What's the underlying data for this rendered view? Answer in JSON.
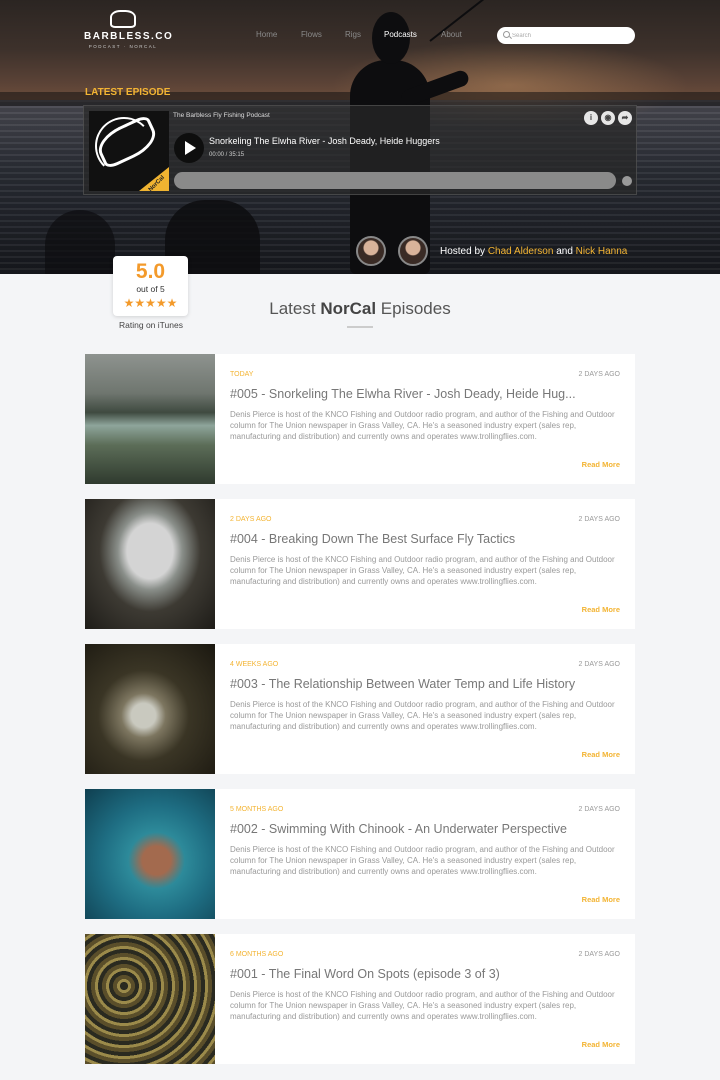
{
  "header": {
    "logo_word": "BARBLESS.CO",
    "logo_sub": "PODCAST · NORCAL",
    "nav": [
      "Home",
      "Flows",
      "Rigs",
      "Podcasts",
      "About"
    ],
    "nav_active": "Podcasts",
    "search_placeholder": "Search"
  },
  "hero": {
    "section_label": "LATEST EPISODE",
    "player": {
      "podcast_name": "The Barbless Fly Fishing Podcast",
      "episode_title": "Snorkeling The Elwha River - Josh Deady, Heide Huggers",
      "time": "00:00 / 35:15",
      "art_tag": "NorCal",
      "icons": [
        "info-icon",
        "podcast-icon",
        "share-icon"
      ]
    },
    "hosted_prefix": "Hosted by",
    "host1": "Chad Alderson",
    "hosted_and": "and",
    "host2": "Nick Hanna"
  },
  "rating": {
    "score": "5.0",
    "out_of": "out of 5",
    "stars": "★★★★★",
    "label": "Rating on iTunes"
  },
  "section": {
    "title_pre": "Latest",
    "title_bold": "NorCal",
    "title_post": "Episodes"
  },
  "episodes": [
    {
      "date": "TODAY",
      "ago": "2 DAYS AGO",
      "title": "#005 - Snorkeling The Elwha River - Josh Deady, Heide Hug...",
      "desc": "Denis Pierce is host of the KNCO Fishing and Outdoor radio program, and author of the Fishing and Outdoor column for The Union newspaper in Grass Valley, CA. He's a seasoned industry expert (sales rep, manufacturing and distribution) and currently owns and operates www.trollingflies.com.",
      "more": "Read More"
    },
    {
      "date": "2 DAYS AGO",
      "ago": "2 DAYS AGO",
      "title": "#004 - Breaking Down The Best Surface Fly Tactics",
      "desc": "Denis Pierce is host of the KNCO Fishing and Outdoor radio program, and author of the Fishing and Outdoor column for The Union newspaper in Grass Valley, CA. He's a seasoned industry expert (sales rep, manufacturing and distribution) and currently owns and operates www.trollingflies.com.",
      "more": "Read More"
    },
    {
      "date": "4 WEEKS AGO",
      "ago": "2 DAYS AGO",
      "title": "#003 - The Relationship Between Water Temp and Life History",
      "desc": "Denis Pierce is host of the KNCO Fishing and Outdoor radio program, and author of the Fishing and Outdoor column for The Union newspaper in Grass Valley, CA. He's a seasoned industry expert (sales rep, manufacturing and distribution) and currently owns and operates www.trollingflies.com.",
      "more": "Read More"
    },
    {
      "date": "5 MONTHS AGO",
      "ago": "2 DAYS AGO",
      "title": "#002 - Swimming With Chinook - An Underwater Perspective",
      "desc": "Denis Pierce is host of the KNCO Fishing and Outdoor radio program, and author of the Fishing and Outdoor column for The Union newspaper in Grass Valley, CA. He's a seasoned industry expert (sales rep, manufacturing and distribution) and currently owns and operates www.trollingflies.com.",
      "more": "Read More"
    },
    {
      "date": "6 MONTHS AGO",
      "ago": "2 DAYS AGO",
      "title": "#001 - The Final Word On Spots (episode 3 of 3)",
      "desc": "Denis Pierce is host of the KNCO Fishing and Outdoor radio program, and author of the Fishing and Outdoor column for The Union newspaper in Grass Valley, CA. He's a seasoned industry expert (sales rep, manufacturing and distribution) and currently owns and operates www.trollingflies.com.",
      "more": "Read More"
    }
  ],
  "colors": {
    "accent": "#f3b433",
    "star": "#f39a2b",
    "page_bg": "#f4f5f7"
  }
}
